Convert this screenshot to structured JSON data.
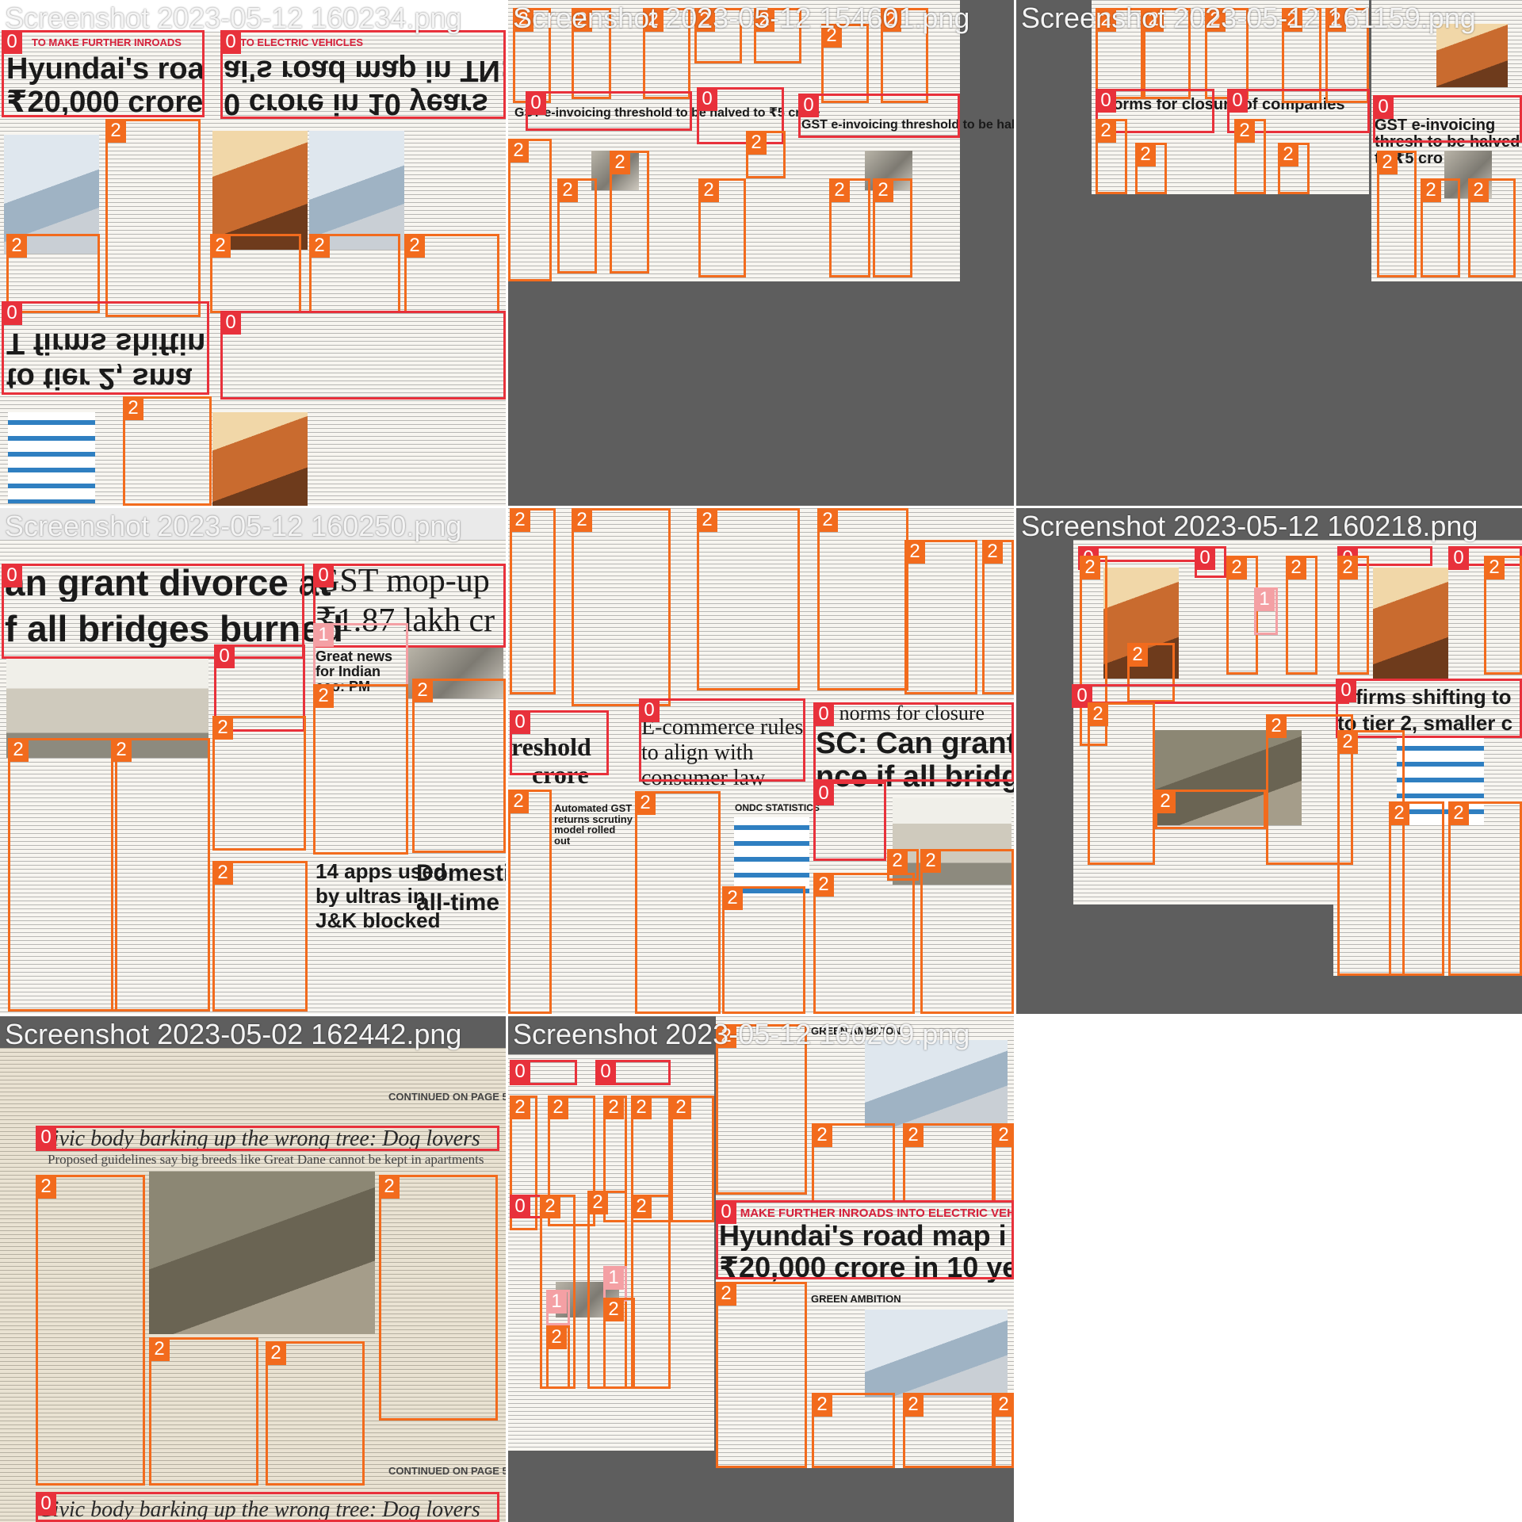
{
  "mosaic": {
    "tiles": [
      {
        "caption": "Screenshot 2023-05-12 160234.png"
      },
      {
        "caption": "Screenshot 2023-05-12 154601.png"
      },
      {
        "caption": "Screenshot 2023-05-12 161159.png"
      },
      {
        "caption": "Screenshot 2023-05-12 160250.png"
      },
      {
        "caption": ""
      },
      {
        "caption": "Screenshot 2023-05-12 160218.png"
      },
      {
        "caption": "Screenshot 2023-05-02 162442.png"
      },
      {
        "caption": "Screenshot 2023-05-12 160209.png"
      },
      {
        "caption": ""
      }
    ]
  },
  "labels": {
    "headline": "0",
    "image": "1",
    "text": "2"
  },
  "colors": {
    "headline": "#e8313b",
    "image": "#f4a0a4",
    "text": "#f26b1d"
  },
  "headlines": {
    "t1_h1a": "Hyundai's roa",
    "t1_h1b": "₹20,000 crore",
    "t1_h2a": "ai's road map in TN:",
    "t1_h2b": "0 crore in 10 years",
    "t1_h3a": "T firms shiftin",
    "t1_h3b": "to tier 2, sma",
    "t1_bar1": "TO MAKE FURTHER INROADS",
    "t1_bar2": "INTO ELECTRIC VEHICLES",
    "t2_h1": "GST e-invoicing threshold to be halved to ₹5 crore",
    "t3_h1": "norms for closure of companies",
    "t3_h2": "GST e-invoicing thresh to be halved to ₹5 cro",
    "t4_h1a": "an grant divorce at",
    "t4_h1b": "f all bridges burned",
    "t4_h2a": "GST mop-up",
    "t4_h2b": "₹1.87 lakh cr",
    "t4_h3": "Great news for Indian eco: PM",
    "t4_h4a": "14 apps used",
    "t4_h4b": "by ultras in",
    "t4_h4c": "J&K blocked",
    "t4_h5a": "Domestic",
    "t4_h5b": "all-time h",
    "t5_h1a": "reshold",
    "t5_h1b": "crore",
    "t5_h2a": "E-commerce rules",
    "t5_h2b": "to align with",
    "t5_h2c": "consumer law",
    "t5_h3": "ns norms for closure",
    "t5_h4a": "SC: Can grant di",
    "t5_h4b": "nce if all bridge",
    "t5_h5": "Automated GST returns scrutiny model rolled out",
    "t5_h6": "ONDC STATISTICS",
    "t6_h1": "T firms shifting to",
    "t6_h2": "to tier 2, smaller c",
    "t7_h1": "Civic body barking up the wrong tree: Dog lovers",
    "t7_h2": "Proposed guidelines say big breeds like Great Dane cannot be kept in apartments",
    "t7_bar": "CONTINUED ON PAGE 5",
    "t8_h1a": "Hyundai's road map i",
    "t8_h1b": "₹20,000 crore in 10 ye",
    "t8_bar": "TO MAKE FURTHER INROADS INTO ELECTRIC VEHI",
    "t8_sub": "GREEN AMBITION"
  }
}
